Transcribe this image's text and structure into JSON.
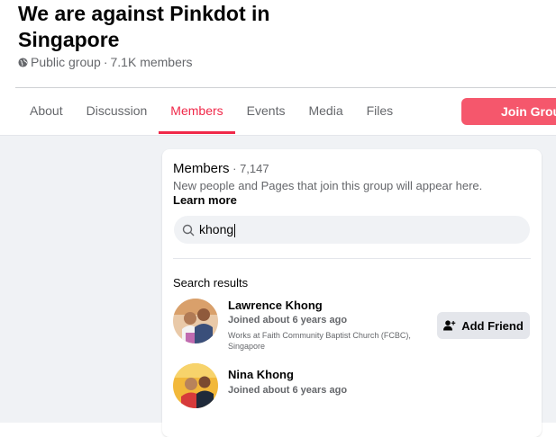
{
  "group": {
    "title": "We are against Pinkdot in Singapore",
    "privacy": "Public group",
    "separator": " · ",
    "member_summary": "7.1K members"
  },
  "tabs": [
    {
      "label": "About"
    },
    {
      "label": "Discussion"
    },
    {
      "label": "Members",
      "active": true
    },
    {
      "label": "Events"
    },
    {
      "label": "Media"
    },
    {
      "label": "Files"
    }
  ],
  "join_button": {
    "label": "Join Grou"
  },
  "members": {
    "label": "Members",
    "count": " · 7,147",
    "description": "New people and Pages that join this group will appear here. ",
    "learn_more": "Learn more"
  },
  "search": {
    "value": "khong"
  },
  "results": {
    "title": "Search results",
    "items": [
      {
        "name": "Lawrence Khong",
        "joined": "Joined about 6 years ago",
        "work": "Works at Faith Community Baptist Church (FCBC), Singapore",
        "action": "Add Friend"
      },
      {
        "name": "Nina Khong",
        "joined": "Joined about 6 years ago"
      }
    ]
  },
  "colors": {
    "accent": "#f02849",
    "join_button": "#f5576c",
    "background": "#f0f2f5"
  },
  "icons": {
    "privacy": "globe-icon",
    "search": "search-icon",
    "add_friend": "add-person-icon"
  }
}
